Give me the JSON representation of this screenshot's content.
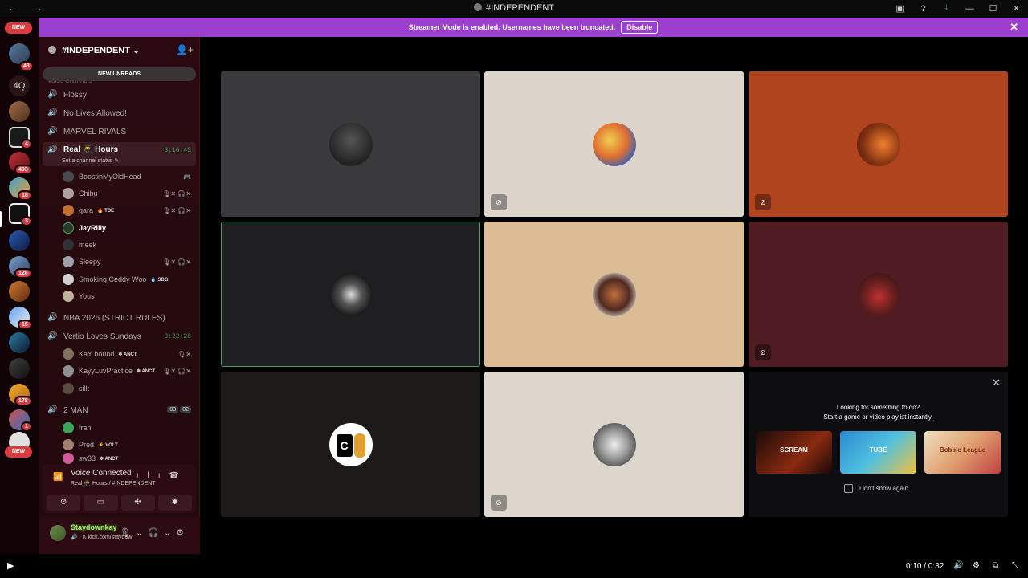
{
  "window": {
    "title": "#INDEPENDENT",
    "nav": "← →"
  },
  "banner": {
    "text": "Streamer Mode is enabled. Usernames have been truncated.",
    "disable_label": "Disable",
    "close_icon": "close-icon"
  },
  "rail": {
    "new_top": "NEW",
    "new_bottom": "NEW",
    "text_server": "4Q",
    "badges": [
      "43",
      "4",
      "403",
      "18",
      "3",
      "126",
      "15",
      "178",
      "1"
    ]
  },
  "server": {
    "name": "#INDEPENDENT",
    "new_unreads": "NEW UNREADS",
    "category_faint": "Voice Channels"
  },
  "channels": [
    {
      "name": "Flossy"
    },
    {
      "name": "No Lives Allowed!"
    },
    {
      "name": "MARVEL RIVALS"
    },
    {
      "name": "Real 🥷 Hours",
      "timer": "3:16:43",
      "status": "Set a channel status ✎"
    },
    {
      "name": "NBA 2026 (STRICT RULES)"
    },
    {
      "name": "Vertio Loves Sundays",
      "timer": "9:22:28"
    },
    {
      "name": "2 MAN",
      "counts": [
        "03",
        "02"
      ]
    }
  ],
  "members_real": [
    {
      "name": "BoostinMyOldHead",
      "tag": "",
      "icons": "🎮"
    },
    {
      "name": "Chibu",
      "tag": "",
      "icons": "🎙✕ 🎧✕"
    },
    {
      "name": "gara",
      "tag": "🔥 TDE",
      "icons": "🎙✕ 🎧✕"
    },
    {
      "name": "JayRilly",
      "tag": "",
      "icons": ""
    },
    {
      "name": "meek",
      "tag": "",
      "icons": ""
    },
    {
      "name": "Sleepy",
      "tag": "",
      "icons": "🎙✕ 🎧✕"
    },
    {
      "name": "Smoking Ceddy Woo",
      "tag": "💧 SDG",
      "icons": ""
    },
    {
      "name": "Yous",
      "tag": "",
      "icons": ""
    }
  ],
  "members_vertio": [
    {
      "name": "KaY hound",
      "tag": "❄ ANCT",
      "icons": "🎙✕"
    },
    {
      "name": "KayyLuvPractice",
      "tag": "❄ ANCT",
      "icons": "🎙✕ 🎧✕"
    },
    {
      "name": "silk",
      "tag": "",
      "icons": ""
    }
  ],
  "members_2man": [
    {
      "name": "fran",
      "tag": "",
      "icons": ""
    },
    {
      "name": "Pred",
      "tag": "⚡ VOLT",
      "icons": ""
    },
    {
      "name": "sw33",
      "tag": "❄ ANCT",
      "icons": ""
    }
  ],
  "voice": {
    "title": "Voice Connected",
    "sub": "Real 🥷 Hours / #INDEPENDENT"
  },
  "user": {
    "name": "Staydownkay",
    "sub": "🔊 · K kick.com/staydow"
  },
  "activity": {
    "line1": "Looking for something to do?",
    "line2": "Start a game or video playlist instantly.",
    "cards": [
      "SCREAM",
      "TUBE",
      "Bobble League"
    ],
    "dont_show": "Don't show again"
  },
  "player": {
    "time": "0:10 / 0:32"
  },
  "colors": {
    "banner": "#9a3fd0",
    "speaking": "#3ba55c",
    "mention_red": "#d83c3e"
  }
}
